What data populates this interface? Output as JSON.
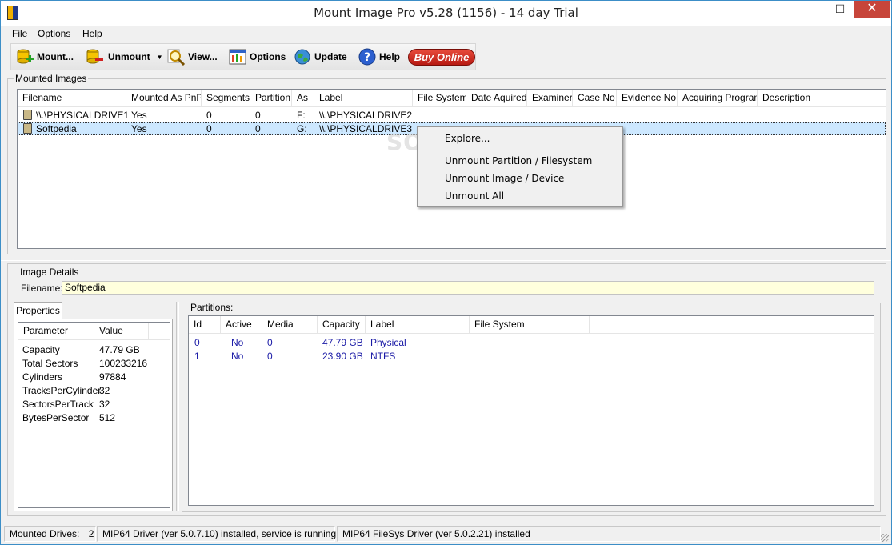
{
  "window": {
    "title": "Mount Image Pro v5.28 (1156) - 14 day Trial",
    "minimize": "–",
    "maximize": "☐",
    "close": "✕"
  },
  "menu": {
    "file": "File",
    "options": "Options",
    "help": "Help"
  },
  "toolbar": {
    "mount": "Mount...",
    "unmount": "Unmount",
    "view": "View...",
    "options": "Options",
    "update": "Update",
    "help": "Help",
    "buy_online": "Buy Online"
  },
  "mounted_images": {
    "group_label": "Mounted Images",
    "columns": [
      "Filename",
      "Mounted As PnP",
      "Segments",
      "Partition",
      "As",
      "Label",
      "File System",
      "Date Aquired",
      "Examiner",
      "Case No",
      "Evidence No",
      "Acquiring Program",
      "Description"
    ],
    "rows": [
      {
        "filename": "\\\\.\\PHYSICALDRIVE1",
        "pnp": "Yes",
        "segments": "0",
        "partition": "0",
        "as": "F:",
        "label": "\\\\.\\PHYSICALDRIVE2"
      },
      {
        "filename": "Softpedia",
        "pnp": "Yes",
        "segments": "0",
        "partition": "0",
        "as": "G:",
        "label": "\\\\.\\PHYSICALDRIVE3"
      }
    ]
  },
  "context_menu": {
    "explore": "Explore...",
    "unmount_partition": "Unmount Partition  / Filesystem",
    "unmount_image": "Unmount Image / Device",
    "unmount_all": "Unmount All"
  },
  "watermark": "SOFTPEDIA",
  "image_details": {
    "group_label": "Image Details",
    "filename_label": "Filename:",
    "filename_value": "Softpedia",
    "tab_properties": "Properties",
    "props_columns": [
      "Parameter",
      "Value"
    ],
    "props": [
      {
        "name": "Capacity",
        "value": "47.79 GB"
      },
      {
        "name": "Total Sectors",
        "value": "100233216"
      },
      {
        "name": "Cylinders",
        "value": "97884"
      },
      {
        "name": "TracksPerCylinder",
        "value": "32"
      },
      {
        "name": "SectorsPerTrack",
        "value": "32"
      },
      {
        "name": "BytesPerSector",
        "value": "512"
      }
    ],
    "partitions_label": "Partitions:",
    "partition_columns": [
      "Id",
      "Active",
      "Media",
      "Capacity",
      "Label",
      "File System"
    ],
    "partitions": [
      {
        "id": "0",
        "active": "No",
        "media": "0",
        "capacity": "47.79 GB",
        "label": "Physical",
        "fs": ""
      },
      {
        "id": "1",
        "active": "No",
        "media": "0",
        "capacity": "23.90 GB",
        "label": "NTFS",
        "fs": ""
      }
    ]
  },
  "status": {
    "mounted_label": "Mounted Drives:",
    "mounted_count": "2",
    "driver1": "MIP64 Driver (ver 5.0.7.10) installed, service is running",
    "driver2": "MIP64 FileSys Driver (ver 5.0.2.21) installed"
  },
  "colors": {
    "selection": "#cde8ff",
    "buy_button": "#d22a1e",
    "details_input": "#ffffdd",
    "partition_text": "#1a1aa6"
  }
}
